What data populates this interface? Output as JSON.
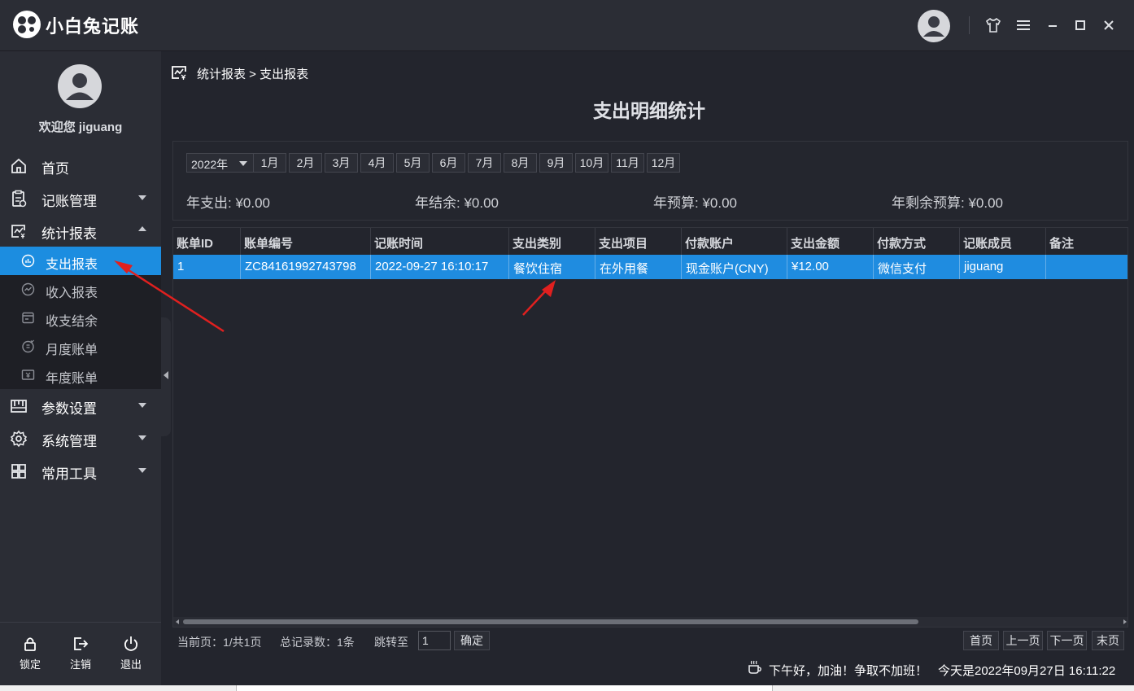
{
  "app": {
    "title": "小白兔记账"
  },
  "titlebar": {
    "buttons": [
      "user-icon",
      "skin-icon",
      "menu-icon",
      "minimize-icon",
      "maximize-icon",
      "close-icon"
    ]
  },
  "sidebar": {
    "welcome": "欢迎您 jiguang",
    "menu": [
      {
        "label": "首页",
        "icon": "home-icon"
      },
      {
        "label": "记账管理",
        "icon": "ledger-icon"
      },
      {
        "label": "统计报表",
        "icon": "report-icon"
      },
      {
        "label": "参数设置",
        "icon": "settings-sliders-icon"
      },
      {
        "label": "系统管理",
        "icon": "gear-icon"
      },
      {
        "label": "常用工具",
        "icon": "grid-icon"
      }
    ],
    "submenu": [
      {
        "label": "支出报表",
        "active": true
      },
      {
        "label": "收入报表"
      },
      {
        "label": "收支结余"
      },
      {
        "label": "月度账单"
      },
      {
        "label": "年度账单"
      }
    ],
    "bottom": [
      {
        "label": "锁定",
        "icon": "lock-icon"
      },
      {
        "label": "注销",
        "icon": "logout-icon"
      },
      {
        "label": "退出",
        "icon": "power-icon"
      }
    ]
  },
  "breadcrumb": "统计报表 > 支出报表",
  "page_title": "支出明细统计",
  "filter": {
    "year": "2022年",
    "months": [
      "1月",
      "2月",
      "3月",
      "4月",
      "5月",
      "6月",
      "7月",
      "8月",
      "9月",
      "10月",
      "11月",
      "12月"
    ]
  },
  "stats": {
    "year_expense": "年支出: ¥0.00",
    "year_balance": "年结余: ¥0.00",
    "year_budget": "年预算: ¥0.00",
    "year_budget_left": "年剩余预算: ¥0.00"
  },
  "table": {
    "columns": [
      "账单ID",
      "账单编号",
      "记账时间",
      "支出类别",
      "支出项目",
      "付款账户",
      "支出金额",
      "付款方式",
      "记账成员",
      "备注"
    ],
    "rows": [
      [
        "1",
        "ZC84161992743798",
        "2022-09-27 16:10:17",
        "餐饮住宿",
        "在外用餐",
        "现金账户(CNY)",
        "¥12.00",
        "微信支付",
        "jiguang",
        ""
      ]
    ]
  },
  "pager": {
    "current": "当前页：1/共1页",
    "total": "总记录数：1条",
    "jump_label": "跳转至",
    "jump_value": "1",
    "confirm": "确定",
    "first": "首页",
    "prev": "上一页",
    "next": "下一页",
    "last": "末页"
  },
  "status": {
    "greeting": "下午好，加油！争取不加班！",
    "today": "今天是2022年09月27日  16:11:22"
  },
  "colors": {
    "accent": "#1c8de0",
    "annotation_arrow": "#e0201f"
  }
}
